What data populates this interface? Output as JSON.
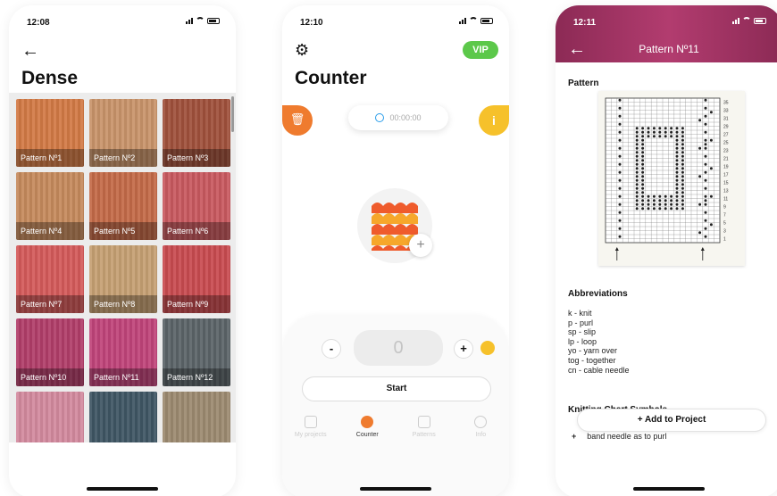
{
  "screen1": {
    "time": "12:08",
    "title": "Dense",
    "tiles": [
      {
        "label": "Pattern Nº1",
        "color": "#d27a45"
      },
      {
        "label": "Pattern Nº2",
        "color": "#c9946a"
      },
      {
        "label": "Pattern Nº3",
        "color": "#a0513c"
      },
      {
        "label": "Pattern Nº4",
        "color": "#c58a5c"
      },
      {
        "label": "Pattern Nº5",
        "color": "#c46a48"
      },
      {
        "label": "Pattern Nº6",
        "color": "#c9595f"
      },
      {
        "label": "Pattern Nº7",
        "color": "#d45a5a"
      },
      {
        "label": "Pattern Nº8",
        "color": "#c6a073"
      },
      {
        "label": "Pattern Nº9",
        "color": "#c94b50"
      },
      {
        "label": "Pattern Nº10",
        "color": "#b13e69"
      },
      {
        "label": "Pattern Nº11",
        "color": "#c0447a"
      },
      {
        "label": "Pattern Nº12",
        "color": "#5b6468"
      },
      {
        "label": "",
        "color": "#d38a9e"
      },
      {
        "label": "",
        "color": "#3f5664"
      },
      {
        "label": "",
        "color": "#9c8a70"
      }
    ]
  },
  "screen2": {
    "time": "12:10",
    "vip_label": "VIP",
    "title": "Counter",
    "timer": "00:00:00",
    "count": "0",
    "minus": "-",
    "plus": "+",
    "start_label": "Start",
    "tabs": [
      {
        "label": "My projects"
      },
      {
        "label": "Counter"
      },
      {
        "label": "Patterns"
      },
      {
        "label": "Info"
      }
    ]
  },
  "screen3": {
    "time": "12:11",
    "title": "Pattern Nº11",
    "pattern_heading": "Pattern",
    "row_numbers": [
      "35",
      "33",
      "31",
      "29",
      "27",
      "25",
      "23",
      "21",
      "19",
      "17",
      "15",
      "13",
      "11",
      "9",
      "7",
      "5",
      "3",
      "1"
    ],
    "abbreviations_heading": "Abbreviations",
    "abbreviations": [
      "k - knit",
      "p - purl",
      "sp - slip",
      "lp - loop",
      "yo - yarn over",
      "tog - together",
      "cn - cable needle"
    ],
    "symbols_heading": "Knitting Chart Symbols",
    "add_button": "+ Add to Project",
    "symbol_row": {
      "symbol": "+",
      "text": "band needle as to purl"
    }
  },
  "colors": {
    "accent_orange": "#ef7b2e",
    "accent_yellow": "#f6c12b",
    "vip_green": "#5cc84a",
    "header_magenta": "#a3366a"
  }
}
